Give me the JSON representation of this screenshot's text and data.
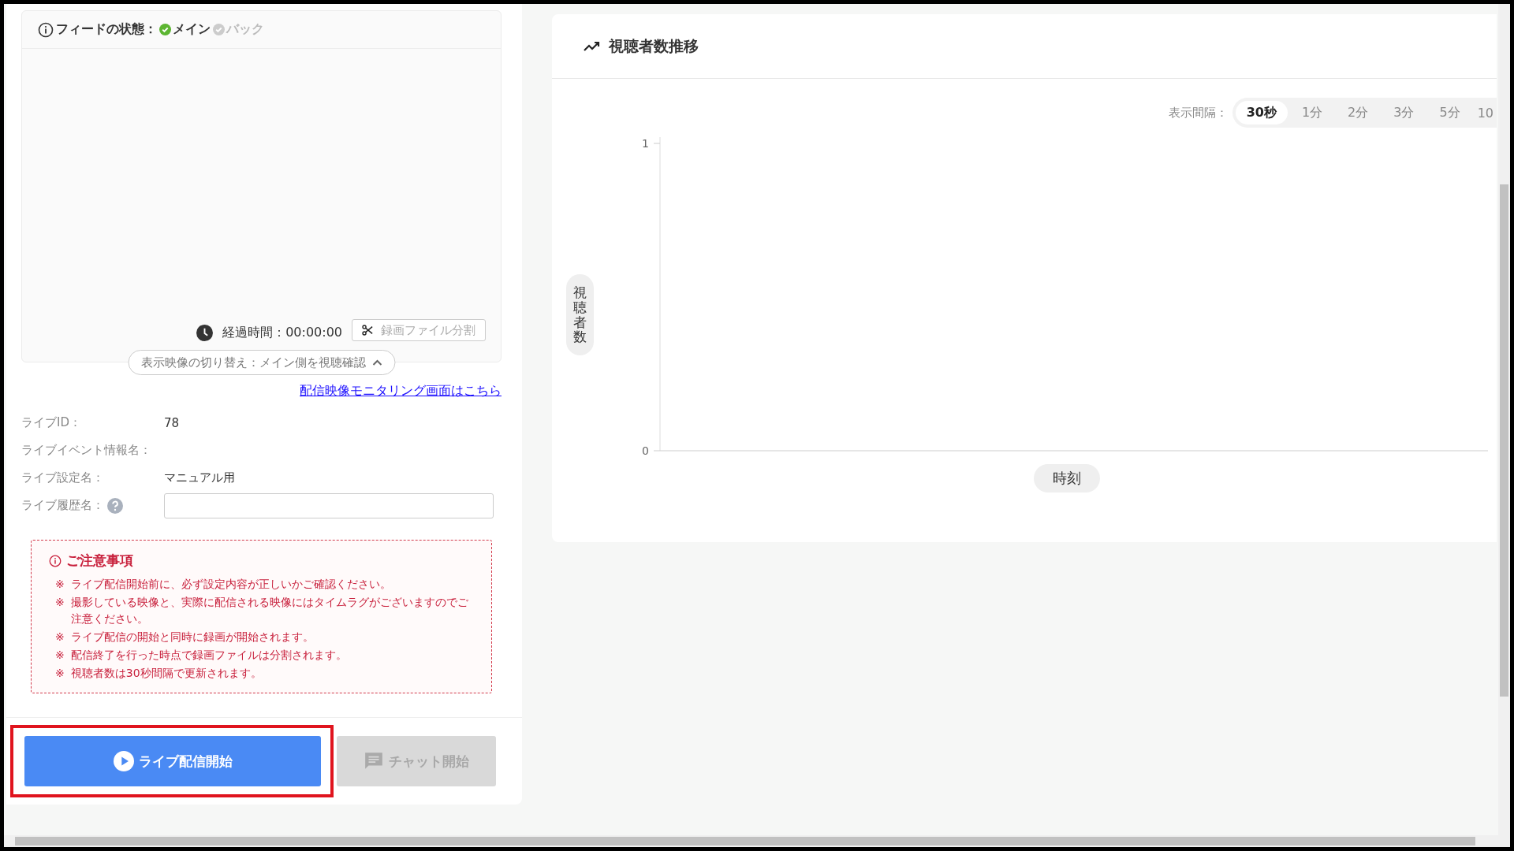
{
  "feed_status": {
    "label": "フィードの状態：",
    "sources": [
      {
        "label": "メイン",
        "on": true
      },
      {
        "label": "バック",
        "on": false
      }
    ]
  },
  "elapsed": {
    "label": "経過時間：",
    "value": "00:00:00"
  },
  "split_button": {
    "label": "録画ファイル分割",
    "disabled": true
  },
  "view_toggle": {
    "label": "表示映像の切り替え：メイン側を視聴確認",
    "expanded": true
  },
  "monitor_link": "配信映像モニタリング画面はこちら",
  "info_rows": [
    {
      "kind": "text",
      "label": "ライブID：",
      "value": "78"
    },
    {
      "kind": "text",
      "label": "ライブイベント情報名："
    },
    {
      "kind": "text",
      "label": "ライブ設定名：",
      "value": "マニュアル用"
    },
    {
      "kind": "input",
      "label": "ライブ履歴名：",
      "help": true
    }
  ],
  "notice": {
    "title": "ご注意事項",
    "items": [
      {
        "mark": "※",
        "text": "ライブ配信開始前に、必ず設定内容が正しいかご確認ください。"
      },
      {
        "mark": "※",
        "text": "撮影している映像と、実際に配信される映像にはタイムラグがございますのでご注意ください。"
      },
      {
        "mark": "※",
        "text": "ライブ配信の開始と同時に録画が開始されます。"
      },
      {
        "mark": "※",
        "text": "配信終了を行った時点で録画ファイルは分割されます。"
      },
      {
        "mark": "※",
        "text": "視聴者数は30秒間隔で更新されます。"
      }
    ]
  },
  "buttons": [
    {
      "kind": "start",
      "label": "ライブ配信開始",
      "disabled": false,
      "highlighted": true
    },
    {
      "kind": "chat",
      "label": "チャット開始",
      "disabled": true,
      "highlighted": false
    }
  ],
  "chart_panel": {
    "title": "視聴者数推移",
    "interval_label": "表示間隔：",
    "intervals": [
      {
        "label": "30秒",
        "selected": true
      },
      {
        "label": "1分",
        "selected": false
      },
      {
        "label": "2分",
        "selected": false
      },
      {
        "label": "3分",
        "selected": false
      },
      {
        "label": "5分",
        "selected": false
      },
      {
        "label": "10",
        "selected": false
      }
    ],
    "chart": {
      "xlabel": "時刻",
      "ylabel": "視聴者数",
      "y_ticks": [
        "1",
        "0"
      ]
    }
  }
}
